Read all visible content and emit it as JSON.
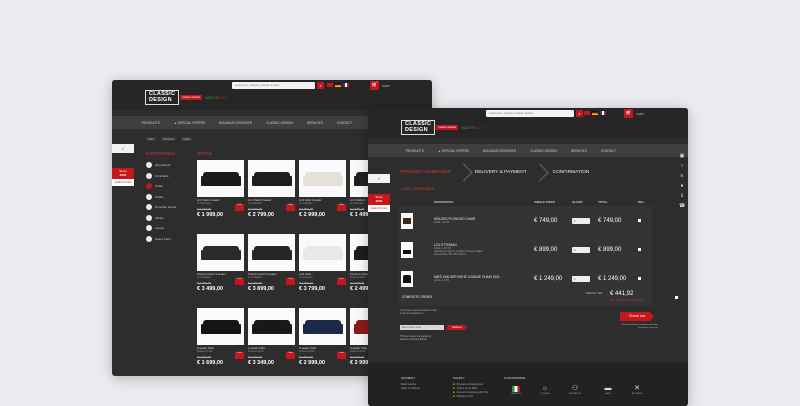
{
  "brand": {
    "name_line1": "CLASSIC",
    "name_line2": "DESIGN",
    "badge": "modern classics",
    "made_in_a": "MADE IN ",
    "made_in_b": "ITALY"
  },
  "search": {
    "placeholder": "Insert item, category, article number",
    "icon": "search-icon"
  },
  "cart": {
    "label": "CART",
    "icon": "cart-icon"
  },
  "nav": {
    "items": [
      "PRODUCTS",
      "SPECIAL OFFERS",
      "BAUHAUS DESIGNER",
      "CLASSIC DESIGN",
      "SERVICES",
      "CONTACT"
    ],
    "special_icon": "fire-icon"
  },
  "listing": {
    "breadcrumb": [
      "Start",
      "Products",
      "Sofas"
    ],
    "categories_title": "CATEGORIES",
    "sofas_title": "SOFAS",
    "categories": [
      "All products",
      "Armchairs",
      "Sofas",
      "Chairs",
      "Armchair Group",
      "Tables",
      "Lamps",
      "Spare Parts"
    ],
    "ribbon": {
      "top": "Since",
      "year": "2001",
      "text": "Quality Promise"
    },
    "products": [
      {
        "name": "LC2 Sofa 3 seater",
        "sub": "Le Corbusier",
        "old": "€ 2 199,00",
        "price": "€ 1 999,00",
        "color": "#1a1a1a"
      },
      {
        "name": "LC 3 Sofa 3 seater",
        "sub": "Le Corbusier",
        "old": "€ 3 299,00",
        "price": "€ 2 799,00",
        "color": "#1e1e1e"
      },
      {
        "name": "LC3 Sofa 3 seater",
        "sub": "Le Corbusier",
        "old": "€ 3 899,00",
        "price": "€ 2 999,00",
        "color": "#e5e0d8"
      },
      {
        "name": "LC 2 Sofa 2",
        "sub": "Le Corbusier",
        "old": "€ 1 999,00",
        "price": "€ 1 499,00",
        "color": "#202020"
      },
      {
        "name": "Grand Confort 3-seater",
        "sub": "Le Corbusier",
        "old": "€ 4 499,00",
        "price": "€ 3 499,00",
        "color": "#2a2a2a"
      },
      {
        "name": "Grand Confort 3-seater",
        "sub": "Le Corbusier",
        "old": "€ 4 299,00",
        "price": "€ 3 899,00",
        "color": "#262626"
      },
      {
        "name": "Lobi Sofa",
        "sub": "Le Corbusier",
        "old": "€ 4 699,00",
        "price": "€ 3 799,00",
        "color": "#e8e8e8"
      },
      {
        "name": "Florence Sofa",
        "sub": "Florence Knoll",
        "old": "€ 2 999,00",
        "price": "€ 2 499,00",
        "color": "#1c1c1c"
      },
      {
        "name": "3-seater Sofa",
        "sub": "Florence Knoll",
        "old": "€ 2 399,00",
        "price": "€ 1 699,00",
        "color": "#151515"
      },
      {
        "name": "2-seater Sofa",
        "sub": "Florence Knoll",
        "old": "€ 3 999,00",
        "price": "€ 3 349,00",
        "color": "#181818"
      },
      {
        "name": "2-seater Sofa",
        "sub": "Florence Knoll",
        "old": "€ 3 899,00",
        "price": "€ 2 999,00",
        "color": "#1b2a4a"
      },
      {
        "name": "3-seater Sofa",
        "sub": "Florence Knoll",
        "old": "€ 3 199,00",
        "price": "€ 2 999,00",
        "color": "#8a1a1a"
      }
    ],
    "sale_label": "Sale"
  },
  "checkout": {
    "steps": [
      "PRODUCT OVERVIEW",
      "DELIVERY & PAYMENT",
      "CONFIRMATION"
    ],
    "section_title": "CART OVERVIEW",
    "headers": [
      "PROPERTIES",
      "SINGLE PRICE",
      "QUANT.",
      "TOTAL",
      "DEL."
    ],
    "items": [
      {
        "name": "MOLDED PLYWOOD CHAIR",
        "article": "Article: 12 CP",
        "single": "€ 749,00",
        "qty": "1",
        "total": "€ 749,00"
      },
      {
        "name": "LC3 OTTOMAN",
        "article": "Article: LC3 OT",
        "detail1": "Upholstery options: Leather Premium, Black",
        "detail2": "Dimensions: 55 x 55 x 38 cm",
        "single": "€ 899,00",
        "qty": "1",
        "total": "€ 899,00"
      },
      {
        "name": "MIES VAN DER ROHE LOUNGE CHAIR 1931",
        "article": "Article: LC 60",
        "single": "€ 1 249,00",
        "qty": "1",
        "total": "€ 1 249,00"
      }
    ],
    "complete_label": "COMPLETE ORDER",
    "total_label": "Total incl. VAT",
    "total": "€ 441,92",
    "total_note": "incl. 19% VAT / free shipping",
    "promo_text_1": "If you have received a promo code,",
    "promo_text_2": "it can be entered here:",
    "promo_placeholder": "Enter promo code",
    "promo_button": "Redeem",
    "promo_note_1": "*Promo code is not applied to",
    "promo_note_2": "already reduced products",
    "checkout_button": "Check out",
    "checkout_note": "Click the button to continue and make payment in your cart"
  },
  "footer": {
    "payment_title": "PAYMENT",
    "payment_items": [
      "Bank transfer",
      "Cash on delivery"
    ],
    "safety_title": "SAFETY",
    "safety_items": [
      "20 years of experience",
      "Online since 2001",
      "Secured shopping with SSL",
      "Delivery in EU"
    ],
    "promise_title": "OUR PROMISE",
    "promise_icons": [
      {
        "icon": "italy-flag-icon",
        "label": "MADE IN"
      },
      {
        "icon": "lightbulb-icon",
        "label": "IT WORK"
      },
      {
        "icon": "people-icon",
        "label": "EXPERTISE"
      },
      {
        "icon": "truck-icon",
        "label": "SAFE"
      },
      {
        "icon": "tools-icon",
        "label": "RETURNS"
      }
    ]
  }
}
